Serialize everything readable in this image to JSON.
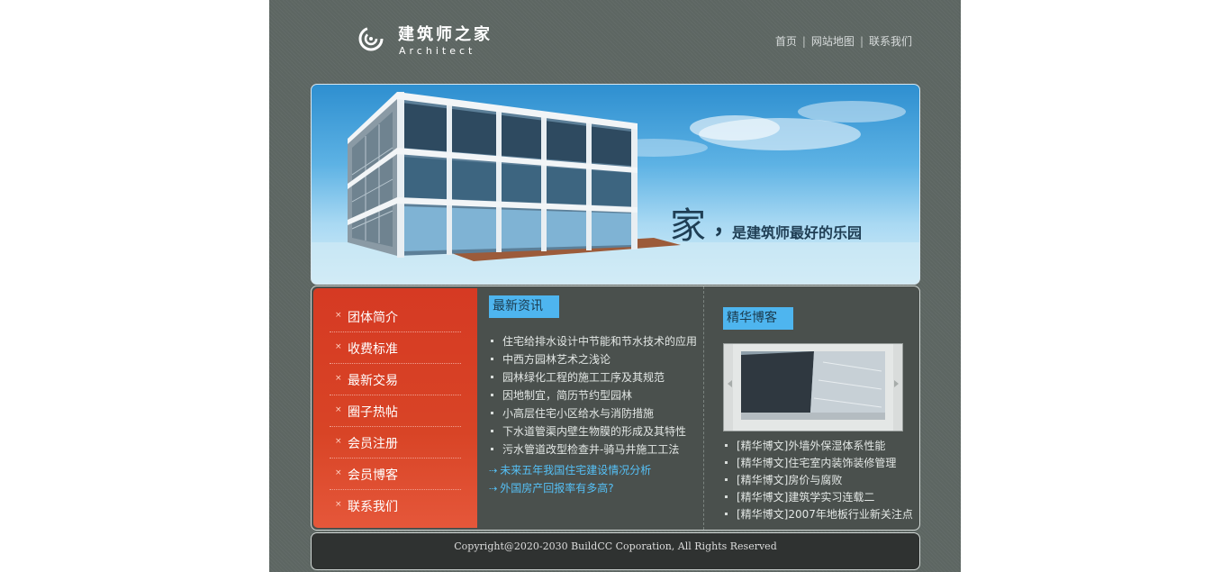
{
  "header": {
    "logo_cn": "建筑师之家",
    "logo_en": "Architect",
    "nav": [
      {
        "label": "首页"
      },
      {
        "label": "网站地图"
      },
      {
        "label": "联系我们"
      }
    ],
    "separator": "|"
  },
  "banner": {
    "slogan_big": "家",
    "slogan_comma": "，",
    "slogan_rest": "是建筑师最好的乐园"
  },
  "sidebar": {
    "bullet": "×",
    "items": [
      {
        "label": "团体简介"
      },
      {
        "label": "收费标准"
      },
      {
        "label": "最新交易"
      },
      {
        "label": "圈子热帖"
      },
      {
        "label": "会员注册"
      },
      {
        "label": "会员博客"
      },
      {
        "label": "联系我们"
      }
    ]
  },
  "news": {
    "title": "最新资讯",
    "items": [
      "住宅给排水设计中节能和节水技术的应用",
      "中西方园林艺术之浅论",
      "园林绿化工程的施工工序及其规范",
      "因地制宜，简历节约型园林",
      "小高层住宅小区给水与消防措施",
      "下水道管渠内壁生物膜的形成及其特性",
      "污水管道改型检查井-骑马井施工工法"
    ],
    "arrow": "⇢",
    "links": [
      "未来五年我国住宅建设情况分析",
      "外国房产回报率有多高?"
    ]
  },
  "blog": {
    "title": "精华博客",
    "items": [
      "[精华博文]外墙外保湿体系性能",
      "[精华博文]住宅室内装饰装修管理",
      "[精华博文]房价与腐败",
      "[精华博文]建筑学实习连载二",
      "[精华博文]2007年地板行业新关注点"
    ]
  },
  "footer": {
    "copyright": "Copyright@2020-2030 BuildCC Coporation, All Rights Reserved"
  },
  "colors": {
    "page_bg": "#5d6662",
    "accent_blue": "#4eb5ef",
    "sidebar_red": "#d63a23",
    "link_blue": "#55c0f6"
  }
}
